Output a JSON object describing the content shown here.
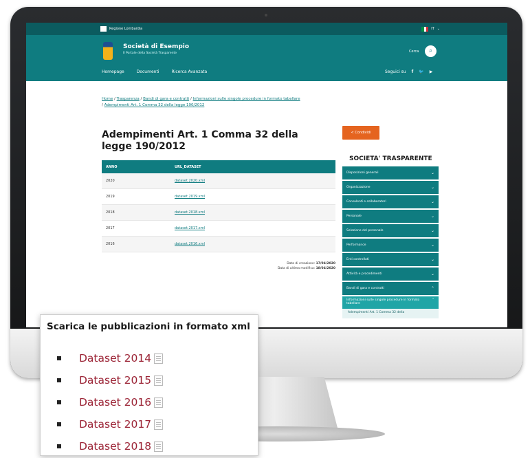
{
  "topbar": {
    "org": "Regione Lombardia",
    "lang": "IT"
  },
  "header": {
    "site_title": "Società di Esempio",
    "site_subtitle": "Il Portale della Società Trasparente",
    "search_label": "Cerca",
    "social_label": "Seguici su"
  },
  "nav": {
    "items": [
      "Homepage",
      "Documenti",
      "Ricerca Avanzata"
    ]
  },
  "breadcrumb": {
    "items": [
      "Home",
      "Trasparenza",
      "Bandi di gara e contratti",
      "Informazioni sulle singole procedure in formato tabellare",
      "Adempimenti Art. 1 Comma 32 della legge 190/2012"
    ]
  },
  "page": {
    "title": "Adempimenti Art. 1 Comma 32 della legge 190/2012"
  },
  "table": {
    "headers": [
      "ANNO",
      "URL_DATASET"
    ],
    "rows": [
      {
        "anno": "2020",
        "url": "dataset.2020.xml"
      },
      {
        "anno": "2019",
        "url": "dataset.2019.xml"
      },
      {
        "anno": "2018",
        "url": "dataset.2018.xml"
      },
      {
        "anno": "2017",
        "url": "dataset.2017.xml"
      },
      {
        "anno": "2016",
        "url": "dataset.2016.xml"
      }
    ]
  },
  "dates": {
    "created_label": "Data di creazione:",
    "created": "17/04/2020",
    "modified_label": "Data di ultima modifica:",
    "modified": "18/04/2020"
  },
  "share": {
    "label": "Condividi"
  },
  "sidebar": {
    "title": "SOCIETA' TRASPARENTE",
    "items": [
      "Disposizioni generali",
      "Organizzazione",
      "Consulenti e collaboratori",
      "Personale",
      "Selezione del personale",
      "Performance",
      "Enti controllati",
      "Attività e procedimenti",
      "Bandi di gara e contratti"
    ],
    "active": "Informazioni sulle singole procedure in formato tabellare",
    "sub": "Adempimenti Art. 1 Comma 32 della"
  },
  "callout": {
    "title": "Scarica le pubblicazioni in formato xml",
    "items": [
      "Dataset 2014",
      "Dataset 2015",
      "Dataset 2016",
      "Dataset 2017",
      "Dataset 2018"
    ]
  },
  "colors": {
    "primary": "#0f7c80",
    "dark": "#0b5b5f",
    "accent": "#e5641f",
    "link_red": "#9b2335"
  }
}
